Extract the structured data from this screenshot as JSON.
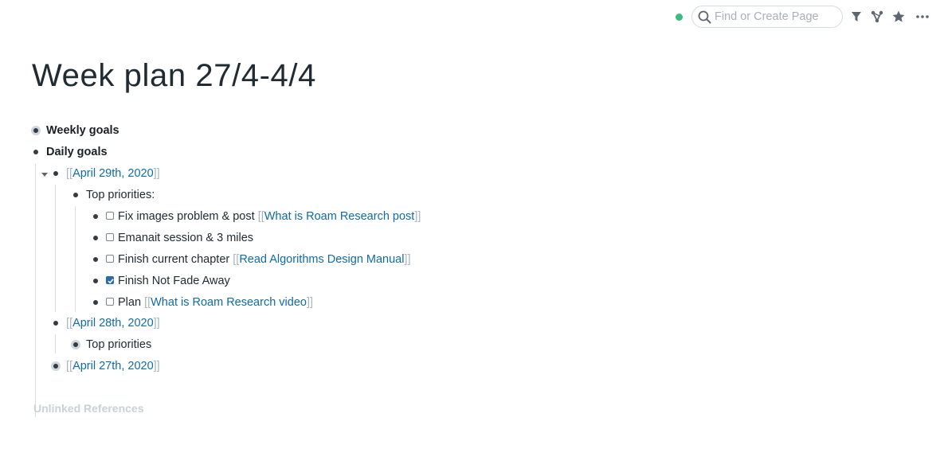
{
  "topbar": {
    "search_placeholder": "Find or Create Page",
    "icons": [
      "sync-status-dot",
      "search-icon",
      "filter-icon",
      "graph-icon",
      "star-icon",
      "more-icon"
    ]
  },
  "page": {
    "title": "Week plan 27/4-4/4"
  },
  "blocks": {
    "weekly_goals": "Weekly goals",
    "daily_goals": "Daily goals",
    "april29": {
      "link": "April 29th, 2020",
      "top_priorities": "Top priorities:",
      "todos": [
        {
          "text": "Fix images problem & post ",
          "link": "What is Roam Research post",
          "checked": false
        },
        {
          "text": "Emanait session & 3 miles",
          "link": "",
          "checked": false
        },
        {
          "text": "Finish current chapter ",
          "link": "Read Algorithms Design Manual",
          "checked": false
        },
        {
          "text": "Finish Not Fade Away",
          "link": "",
          "checked": true
        },
        {
          "text": "Plan ",
          "link": "What is Roam Research video",
          "checked": false
        }
      ]
    },
    "april28": {
      "link": "April 28th, 2020",
      "top_priorities": "Top priorities"
    },
    "april27": {
      "link": "April 27th, 2020"
    }
  },
  "bracket_open": "[[",
  "bracket_close": "]]",
  "unlinked_references": "Unlinked References",
  "colors": {
    "link": "#106ba3",
    "bracket": "#a7b6c2",
    "sync": "#3dbb7a",
    "checkbox_checked": "#2b6ca8"
  }
}
